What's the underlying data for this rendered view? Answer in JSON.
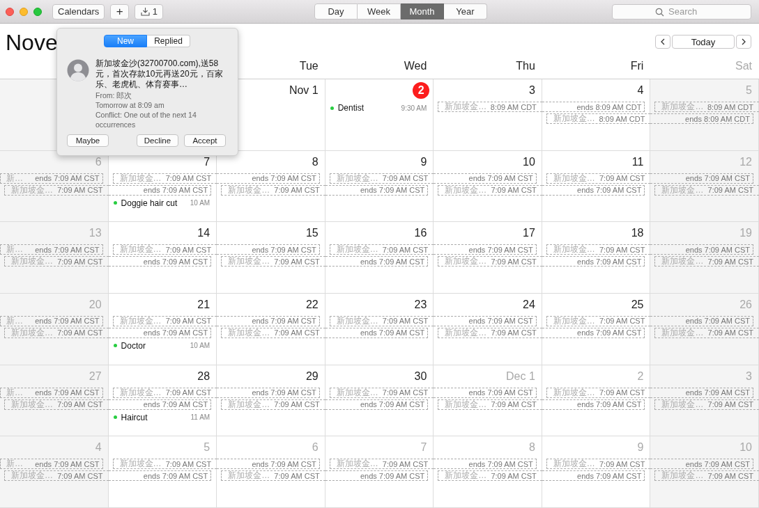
{
  "toolbar": {
    "calendars_button": "Calendars",
    "add_button": "+",
    "inbox_count": "1",
    "views": [
      {
        "label": "Day",
        "selected": false
      },
      {
        "label": "Week",
        "selected": false
      },
      {
        "label": "Month",
        "selected": true
      },
      {
        "label": "Year",
        "selected": false
      }
    ],
    "search": {
      "placeholder": "Search"
    }
  },
  "header": {
    "title": "Nove",
    "today_button": "Today"
  },
  "weekdays": [
    {
      "label": "Tue",
      "weekend": false
    },
    {
      "label": "Wed",
      "weekend": false
    },
    {
      "label": "Thu",
      "weekend": false
    },
    {
      "label": "Fri",
      "weekend": false
    },
    {
      "label": "Sat",
      "weekend": true
    }
  ],
  "weeks": [
    {
      "cells": [
        {},
        {},
        {
          "day": "Nov 1",
          "other_month": false
        },
        {
          "day": "2",
          "today": true,
          "events": [
            {
              "kind": "timed",
              "title": "Dentist",
              "time": "9:30 AM",
              "color": "#28cd41"
            }
          ]
        },
        {
          "day": "3",
          "other_month": false,
          "events": [
            {
              "kind": "start",
              "title": "新加坡金…",
              "time": "8:09 AM CDT"
            }
          ]
        },
        {
          "day": "4",
          "other_month": false,
          "events": [
            {
              "kind": "end",
              "time": "ends 8:09 AM CDT"
            },
            {
              "kind": "start",
              "title": "新加坡金…",
              "time": "8:09 AM CDT"
            }
          ]
        },
        {
          "day": "5",
          "events": [
            {
              "kind": "start",
              "title": "新加坡金…",
              "time": "8:09 AM CDT"
            },
            {
              "kind": "end",
              "time": "ends 8:09 AM CDT"
            }
          ]
        }
      ]
    },
    {
      "cells": [
        {
          "day": "6",
          "events": [
            {
              "kind": "end",
              "title": "新…",
              "time": "ends 7:09 AM CST"
            },
            {
              "kind": "start",
              "title": "新加坡金…",
              "time": "7:09 AM CST"
            }
          ]
        },
        {
          "day": "7",
          "other_month": false,
          "events": [
            {
              "kind": "start",
              "title": "新加坡金…",
              "time": "7:09 AM CST"
            },
            {
              "kind": "end",
              "time": "ends 7:09 AM CST"
            },
            {
              "kind": "timed",
              "title": "Doggie hair cut",
              "time": "10 AM",
              "color": "#28cd41"
            }
          ]
        },
        {
          "day": "8",
          "other_month": false,
          "events": [
            {
              "kind": "end",
              "time": "ends 7:09 AM CST"
            },
            {
              "kind": "start",
              "title": "新加坡金…",
              "time": "7:09 AM CST"
            }
          ]
        },
        {
          "day": "9",
          "other_month": false,
          "events": [
            {
              "kind": "start",
              "title": "新加坡金…",
              "time": "7:09 AM CST"
            },
            {
              "kind": "end",
              "time": "ends 7:09 AM CST"
            }
          ]
        },
        {
          "day": "10",
          "other_month": false,
          "events": [
            {
              "kind": "end",
              "time": "ends 7:09 AM CST"
            },
            {
              "kind": "start",
              "title": "新加坡金…",
              "time": "7:09 AM CST"
            }
          ]
        },
        {
          "day": "11",
          "other_month": false,
          "events": [
            {
              "kind": "start",
              "title": "新加坡金…",
              "time": "7:09 AM CST"
            },
            {
              "kind": "end",
              "time": "ends 7:09 AM CST"
            }
          ]
        },
        {
          "day": "12",
          "events": [
            {
              "kind": "end",
              "time": "ends 7:09 AM CST"
            },
            {
              "kind": "start",
              "title": "新加坡金…",
              "time": "7:09 AM CST"
            }
          ]
        }
      ]
    },
    {
      "cells": [
        {
          "day": "13",
          "events": [
            {
              "kind": "end",
              "title": "新…",
              "time": "ends 7:09 AM CST"
            },
            {
              "kind": "start",
              "title": "新加坡金…",
              "time": "7:09 AM CST"
            }
          ]
        },
        {
          "day": "14",
          "other_month": false,
          "events": [
            {
              "kind": "start",
              "title": "新加坡金…",
              "time": "7:09 AM CST"
            },
            {
              "kind": "end",
              "time": "ends 7:09 AM CST"
            }
          ]
        },
        {
          "day": "15",
          "other_month": false,
          "events": [
            {
              "kind": "end",
              "time": "ends 7:09 AM CST"
            },
            {
              "kind": "start",
              "title": "新加坡金…",
              "time": "7:09 AM CST"
            }
          ]
        },
        {
          "day": "16",
          "other_month": false,
          "events": [
            {
              "kind": "start",
              "title": "新加坡金…",
              "time": "7:09 AM CST"
            },
            {
              "kind": "end",
              "time": "ends 7:09 AM CST"
            }
          ]
        },
        {
          "day": "17",
          "other_month": false,
          "events": [
            {
              "kind": "end",
              "time": "ends 7:09 AM CST"
            },
            {
              "kind": "start",
              "title": "新加坡金…",
              "time": "7:09 AM CST"
            }
          ]
        },
        {
          "day": "18",
          "other_month": false,
          "events": [
            {
              "kind": "start",
              "title": "新加坡金…",
              "time": "7:09 AM CST"
            },
            {
              "kind": "end",
              "time": "ends 7:09 AM CST"
            }
          ]
        },
        {
          "day": "19",
          "events": [
            {
              "kind": "end",
              "time": "ends 7:09 AM CST"
            },
            {
              "kind": "start",
              "title": "新加坡金…",
              "time": "7:09 AM CST"
            }
          ]
        }
      ]
    },
    {
      "cells": [
        {
          "day": "20",
          "events": [
            {
              "kind": "end",
              "title": "新…",
              "time": "ends 7:09 AM CST"
            },
            {
              "kind": "start",
              "title": "新加坡金…",
              "time": "7:09 AM CST"
            }
          ]
        },
        {
          "day": "21",
          "other_month": false,
          "events": [
            {
              "kind": "start",
              "title": "新加坡金…",
              "time": "7:09 AM CST"
            },
            {
              "kind": "end",
              "time": "ends 7:09 AM CST"
            },
            {
              "kind": "timed",
              "title": "Doctor",
              "time": "10 AM",
              "color": "#28cd41"
            }
          ]
        },
        {
          "day": "22",
          "other_month": false,
          "events": [
            {
              "kind": "end",
              "time": "ends 7:09 AM CST"
            },
            {
              "kind": "start",
              "title": "新加坡金…",
              "time": "7:09 AM CST"
            }
          ]
        },
        {
          "day": "23",
          "other_month": false,
          "events": [
            {
              "kind": "start",
              "title": "新加坡金…",
              "time": "7:09 AM CST"
            },
            {
              "kind": "end",
              "time": "ends 7:09 AM CST"
            }
          ]
        },
        {
          "day": "24",
          "other_month": false,
          "events": [
            {
              "kind": "end",
              "time": "ends 7:09 AM CST"
            },
            {
              "kind": "start",
              "title": "新加坡金…",
              "time": "7:09 AM CST"
            }
          ]
        },
        {
          "day": "25",
          "other_month": false,
          "events": [
            {
              "kind": "start",
              "title": "新加坡金…",
              "time": "7:09 AM CST"
            },
            {
              "kind": "end",
              "time": "ends 7:09 AM CST"
            }
          ]
        },
        {
          "day": "26",
          "events": [
            {
              "kind": "end",
              "time": "ends 7:09 AM CST"
            },
            {
              "kind": "start",
              "title": "新加坡金…",
              "time": "7:09 AM CST"
            }
          ]
        }
      ]
    },
    {
      "cells": [
        {
          "day": "27",
          "events": [
            {
              "kind": "end",
              "title": "新…",
              "time": "ends 7:09 AM CST"
            },
            {
              "kind": "start",
              "title": "新加坡金…",
              "time": "7:09 AM CST"
            }
          ]
        },
        {
          "day": "28",
          "other_month": false,
          "events": [
            {
              "kind": "start",
              "title": "新加坡金…",
              "time": "7:09 AM CST"
            },
            {
              "kind": "end",
              "time": "ends 7:09 AM CST"
            },
            {
              "kind": "timed",
              "title": "Haircut",
              "time": "11 AM",
              "color": "#28cd41"
            }
          ]
        },
        {
          "day": "29",
          "other_month": false,
          "events": [
            {
              "kind": "end",
              "time": "ends 7:09 AM CST"
            },
            {
              "kind": "start",
              "title": "新加坡金…",
              "time": "7:09 AM CST"
            }
          ]
        },
        {
          "day": "30",
          "other_month": false,
          "events": [
            {
              "kind": "start",
              "title": "新加坡金…",
              "time": "7:09 AM CST"
            },
            {
              "kind": "end",
              "time": "ends 7:09 AM CST"
            }
          ]
        },
        {
          "day": "Dec 1",
          "other_month": true,
          "events": [
            {
              "kind": "end",
              "time": "ends 7:09 AM CST"
            },
            {
              "kind": "start",
              "title": "新加坡金…",
              "time": "7:09 AM CST"
            }
          ]
        },
        {
          "day": "2",
          "other_month": true,
          "events": [
            {
              "kind": "start",
              "title": "新加坡金…",
              "time": "7:09 AM CST"
            },
            {
              "kind": "end",
              "time": "ends 7:09 AM CST"
            }
          ]
        },
        {
          "day": "3",
          "events": [
            {
              "kind": "end",
              "time": "ends 7:09 AM CST"
            },
            {
              "kind": "start",
              "title": "新加坡金…",
              "time": "7:09 AM CST"
            }
          ]
        }
      ]
    },
    {
      "cells": [
        {
          "day": "4",
          "events": [
            {
              "kind": "end",
              "title": "新…",
              "time": "ends 7:09 AM CST"
            },
            {
              "kind": "start",
              "title": "新加坡金…",
              "time": "7:09 AM CST"
            }
          ]
        },
        {
          "day": "5",
          "other_month": true,
          "events": [
            {
              "kind": "start",
              "title": "新加坡金…",
              "time": "7:09 AM CST"
            },
            {
              "kind": "end",
              "time": "ends 7:09 AM CST"
            }
          ]
        },
        {
          "day": "6",
          "other_month": true,
          "events": [
            {
              "kind": "end",
              "time": "ends 7:09 AM CST"
            },
            {
              "kind": "start",
              "title": "新加坡金…",
              "time": "7:09 AM CST"
            }
          ]
        },
        {
          "day": "7",
          "other_month": true,
          "events": [
            {
              "kind": "start",
              "title": "新加坡金…",
              "time": "7:09 AM CST"
            },
            {
              "kind": "end",
              "time": "ends 7:09 AM CST"
            }
          ]
        },
        {
          "day": "8",
          "other_month": true,
          "events": [
            {
              "kind": "end",
              "time": "ends 7:09 AM CST"
            },
            {
              "kind": "start",
              "title": "新加坡金…",
              "time": "7:09 AM CST"
            }
          ]
        },
        {
          "day": "9",
          "other_month": true,
          "events": [
            {
              "kind": "start",
              "title": "新加坡金…",
              "time": "7:09 AM CST"
            },
            {
              "kind": "end",
              "time": "ends 7:09 AM CST"
            }
          ]
        },
        {
          "day": "10",
          "events": [
            {
              "kind": "end",
              "time": "ends 7:09 AM CST"
            },
            {
              "kind": "start",
              "title": "新加坡金…",
              "time": "7:09 AM CST"
            }
          ]
        }
      ]
    }
  ],
  "invitation_popover": {
    "tabs": [
      {
        "label": "New",
        "selected": true
      },
      {
        "label": "Replied",
        "selected": false
      }
    ],
    "title": "新加坡金沙(32700700.com),送58元，首次存款10元再送20元，百家乐、老虎机、体育赛事…",
    "from": "From: 郎次",
    "when": "Tomorrow at 8:09 am",
    "conflict": "Conflict: One out of the next 14 occurrences",
    "buttons": [
      "Maybe",
      "Decline",
      "Accept"
    ]
  }
}
